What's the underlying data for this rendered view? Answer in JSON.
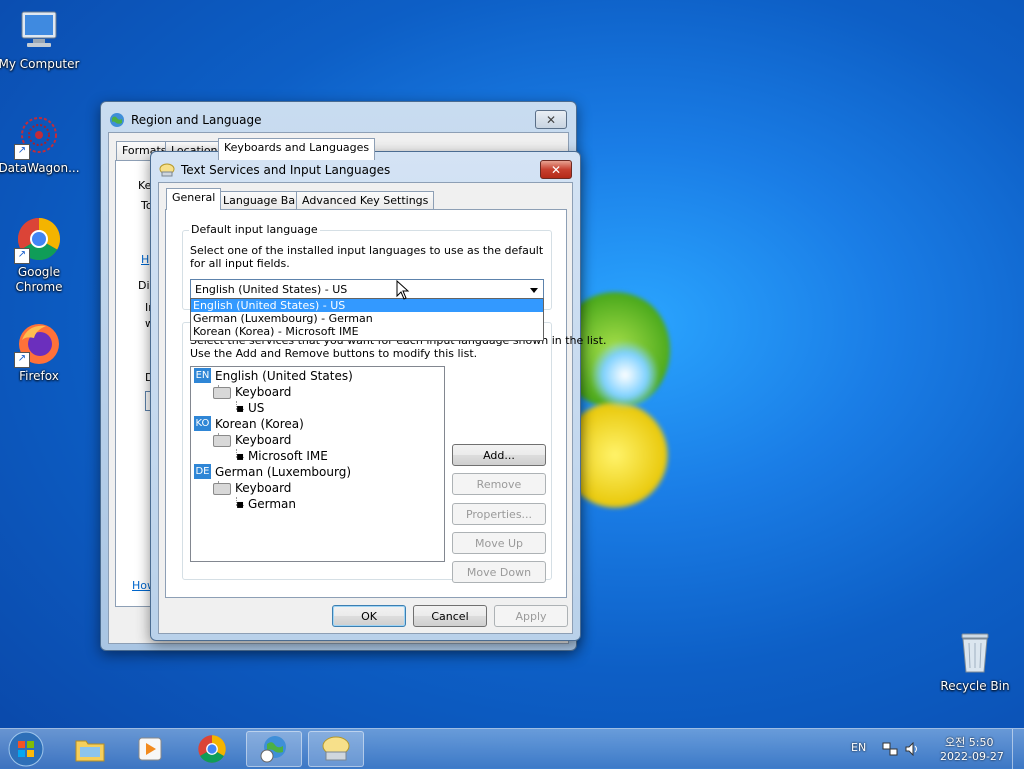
{
  "desktop": {
    "icons": [
      {
        "label": "My Computer",
        "icon": "computer-icon"
      },
      {
        "label": "DataWagon...",
        "icon": "datawagon-icon"
      },
      {
        "label": "Google Chrome",
        "icon": "chrome-icon"
      },
      {
        "label": "Firefox",
        "icon": "firefox-icon"
      },
      {
        "label": "Recycle Bin",
        "icon": "recycle-bin-icon"
      }
    ]
  },
  "region_window": {
    "title": "Region and Language",
    "tabs": [
      "Formats",
      "Location",
      "Keyboards and Languages"
    ],
    "left_fragments": [
      "Ke",
      "To",
      "H",
      "Dis",
      "In",
      "w",
      "D",
      "E",
      "How"
    ]
  },
  "text_services": {
    "title": "Text Services and Input Languages",
    "tabs": [
      "General",
      "Language Bar",
      "Advanced Key Settings"
    ],
    "default_group": {
      "title": "Default input language",
      "description": "Select one of the installed input languages to use as the default for all input fields.",
      "selected": "English (United States) - US",
      "options": [
        "English (United States) - US",
        "German (Luxembourg) - German",
        "Korean (Korea) - Microsoft IME"
      ]
    },
    "services_group": {
      "description_line1": "Select the services that you want for each input language shown in the list.",
      "description_line2": "Use the Add and Remove buttons to modify this list.",
      "tree": [
        {
          "code": "EN",
          "language": "English (United States)",
          "type": "Keyboard",
          "layout": "US"
        },
        {
          "code": "KO",
          "language": "Korean (Korea)",
          "type": "Keyboard",
          "layout": "Microsoft IME"
        },
        {
          "code": "DE",
          "language": "German (Luxembourg)",
          "type": "Keyboard",
          "layout": "German"
        }
      ],
      "buttons": {
        "add": "Add...",
        "remove": "Remove",
        "properties": "Properties...",
        "move_up": "Move Up",
        "move_down": "Move Down"
      }
    },
    "footer": {
      "ok": "OK",
      "cancel": "Cancel",
      "apply": "Apply"
    }
  },
  "taskbar": {
    "lang": "EN",
    "time": "오전 5:50",
    "date": "2022-09-27"
  },
  "colors": {
    "selection": "#3399ff",
    "close_button": "#c7402f",
    "lang_badge": "#2f86d6"
  }
}
